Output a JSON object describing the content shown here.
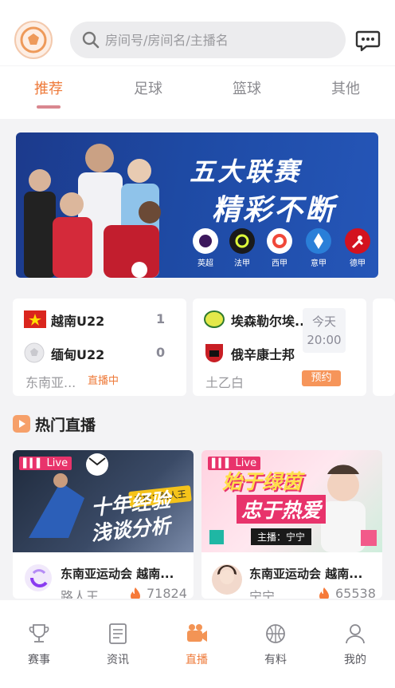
{
  "search": {
    "placeholder": "房间号/房间名/主播名"
  },
  "tabs": [
    {
      "label": "推荐"
    },
    {
      "label": "足球"
    },
    {
      "label": "篮球"
    },
    {
      "label": "其他"
    }
  ],
  "banner": {
    "title_line1": "五大联赛",
    "title_line2": "精彩不断",
    "leagues": [
      {
        "name": "英超"
      },
      {
        "name": "法甲"
      },
      {
        "name": "西甲"
      },
      {
        "name": "意甲"
      },
      {
        "name": "德甲"
      }
    ]
  },
  "matches": [
    {
      "home": "越南U22",
      "home_score": "1",
      "away": "缅甸U22",
      "away_score": "0",
      "league": "东南亚...",
      "status": "直播中"
    },
    {
      "home": "埃森勒尔埃...",
      "away": "俄辛康士邦",
      "time_day": "今天",
      "time": "20:00",
      "league": "土乙白",
      "status": "预约"
    }
  ],
  "hot_section": {
    "title": "热门直播"
  },
  "streams": [
    {
      "badge": "Live",
      "thumb_tag": "主播：路人王",
      "thumb_line1": "十年经验",
      "thumb_line2": "浅谈分析",
      "title": "东南亚运动会  越南...",
      "streamer": "路人王",
      "viewers": "71824"
    },
    {
      "badge": "Live",
      "thumb_line1": "始于绿茵",
      "thumb_line2": "忠于热爱",
      "thumb_tag": "主播：宁宁",
      "title": "东南亚运动会  越南...",
      "streamer": "宁宁",
      "viewers": "65538"
    }
  ],
  "nav": [
    {
      "label": "赛事"
    },
    {
      "label": "资讯"
    },
    {
      "label": "直播"
    },
    {
      "label": "有料"
    },
    {
      "label": "我的"
    }
  ],
  "colors": {
    "accent": "#ee7a3a",
    "live": "#e8336b",
    "brand_blue": "#1e4aa4"
  }
}
